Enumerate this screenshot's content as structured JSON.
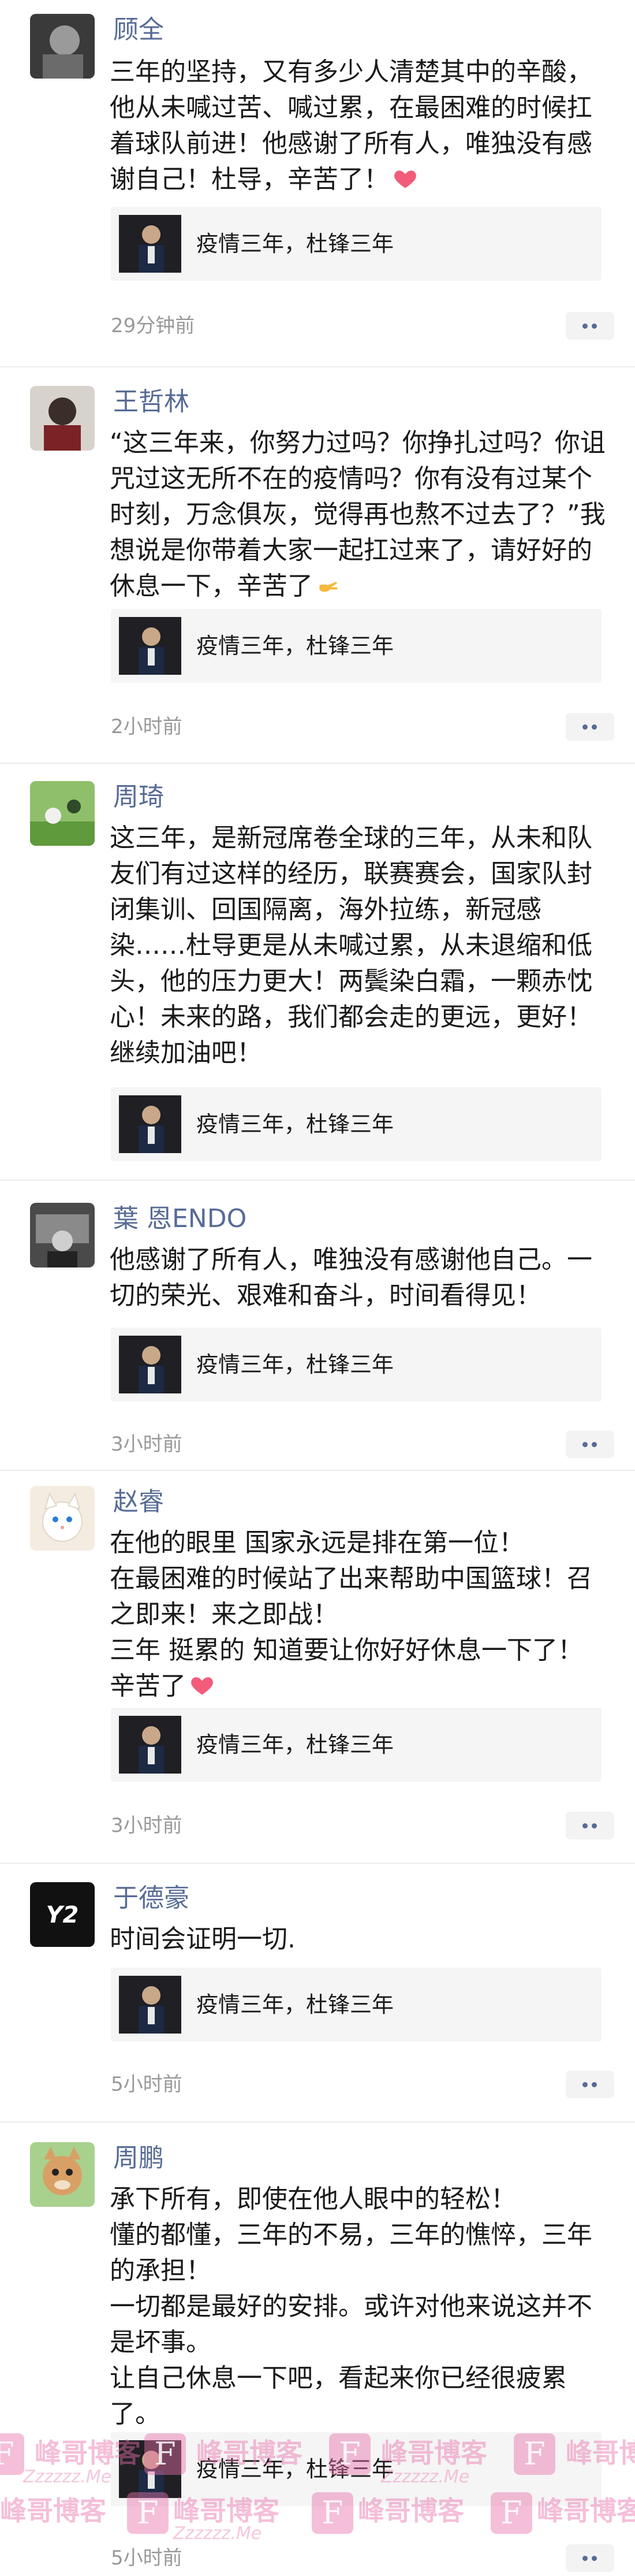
{
  "comments": [
    {
      "name": "顾全",
      "text": "三年的坚持，又有多少人清楚其中的辛酸，他从未喊过苦、喊过累，在最困难的时候扛着球队前进！他感谢了所有人，唯独没有感谢自己！杜导，辛苦了！",
      "emoji": "heart-icon",
      "card_title": "疫情三年，杜锋三年",
      "time": "29分钟前",
      "has_more": true
    },
    {
      "name": "王哲林",
      "text": "“这三年来，你努力过吗？你挣扎过吗？你诅咒过这无所不在的疫情吗？你有没有过某个时刻，万念俱灰，觉得再也熬不过去了？”我想说是你带着大家一起扛过来了，请好好的休息一下，辛苦了",
      "emoji": "hand-icon",
      "card_title": "疫情三年，杜锋三年",
      "time": "2小时前",
      "has_more": true
    },
    {
      "name": "周琦",
      "text": "这三年，是新冠席卷全球的三年，从未和队友们有过这样的经历，联赛赛会，国家队封闭集训、回国隔离，海外拉练，新冠感染……杜导更是从未喊过累，从未退缩和低头，他的压力更大！两鬓染白霜，一颗赤忱心！未来的路，我们都会走的更远，更好！继续加油吧！",
      "emoji": "",
      "card_title": "疫情三年，杜锋三年",
      "time": "",
      "has_more": false
    },
    {
      "name": "葉 恩ENDO",
      "text": "他感谢了所有人，唯独没有感谢他自己。一切的荣光、艰难和奋斗，时间看得见！",
      "emoji": "",
      "card_title": "疫情三年，杜锋三年",
      "time": "3小时前",
      "has_more": true
    },
    {
      "name": "赵睿",
      "text": "在他的眼里 国家永远是排在第一位！\n在最困难的时候站了出来帮助中国篮球！召之即来！来之即战！\n三年 挺累的 知道要让你好好休息一下了！辛苦了",
      "emoji": "heart-icon",
      "card_title": "疫情三年，杜锋三年",
      "time": "3小时前",
      "has_more": true
    },
    {
      "name": "于德豪",
      "text": "时间会证明一切.",
      "emoji": "",
      "card_title": "疫情三年，杜锋三年",
      "time": "5小时前",
      "has_more": true
    },
    {
      "name": "周鹏",
      "text": "承下所有，即使在他人眼中的轻松！\n懂的都懂，三年的不易，三年的憔悴，三年的承担！\n一切都是最好的安排。或许对他来说这并不是坏事。\n让自己休息一下吧，看起来你已经很疲累了。",
      "emoji": "",
      "card_title": "疫情三年，杜锋三年",
      "time": "5小时前",
      "has_more": true
    }
  ],
  "watermark": {
    "text": "峰哥博客",
    "sub": "Zzzzzz.Me",
    "logo": "F"
  },
  "colors": {
    "name": "#576b95",
    "time": "#999999",
    "card_bg": "#f5f5f5",
    "heart": "#f25b7a",
    "watermark": "#e972aa"
  }
}
